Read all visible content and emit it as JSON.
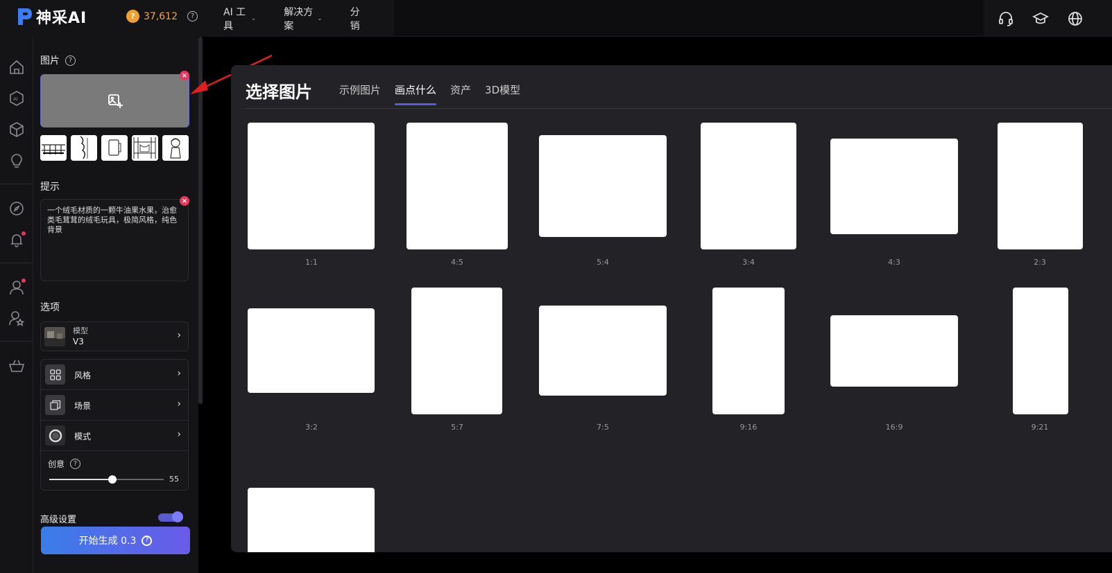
{
  "app": {
    "logo_text": "神采AI",
    "credits": "37,612",
    "coin_symbol": "?",
    "help_symbol": "?"
  },
  "nav": {
    "items": [
      {
        "label": "AI 工具",
        "chevron": "⌄"
      },
      {
        "label": "解决方案",
        "chevron": "⌄"
      },
      {
        "label": "分销",
        "chevron": ""
      }
    ]
  },
  "panel": {
    "image_title": "图片",
    "close_symbol": "×",
    "prompt_title": "提示",
    "prompt_text": "一个绒毛材质的一颗牛油果水果，治愈类毛茸茸的绒毛玩具，极简风格，纯色背景",
    "options_title": "选项",
    "model_label": "模型",
    "model_value": "V3",
    "chevron": "›",
    "options": [
      {
        "label": "风格",
        "icon": "grid-icon"
      },
      {
        "label": "场景",
        "icon": "layers-icon"
      },
      {
        "label": "模式",
        "icon": "ring-icon"
      }
    ],
    "creative_label": "创意",
    "creative_value": 55,
    "advanced_label": "高级设置",
    "generate_label": "开始生成 0.3",
    "generate_coin": "?"
  },
  "dialog": {
    "title": "选择图片",
    "tabs": [
      {
        "label": "示例图片",
        "active": false
      },
      {
        "label": "画点什么",
        "active": true
      },
      {
        "label": "资产",
        "active": false
      },
      {
        "label": "3D模型",
        "active": false
      }
    ],
    "ratios": [
      "1:1",
      "4:5",
      "5:4",
      "3:4",
      "4:3",
      "2:3",
      "3:2",
      "5:7",
      "7:5",
      "9:16",
      "16:9",
      "9:21"
    ]
  },
  "colors": {
    "accent": "#5b5bd6",
    "coin": "#f0a030",
    "alert": "#e8365d"
  }
}
